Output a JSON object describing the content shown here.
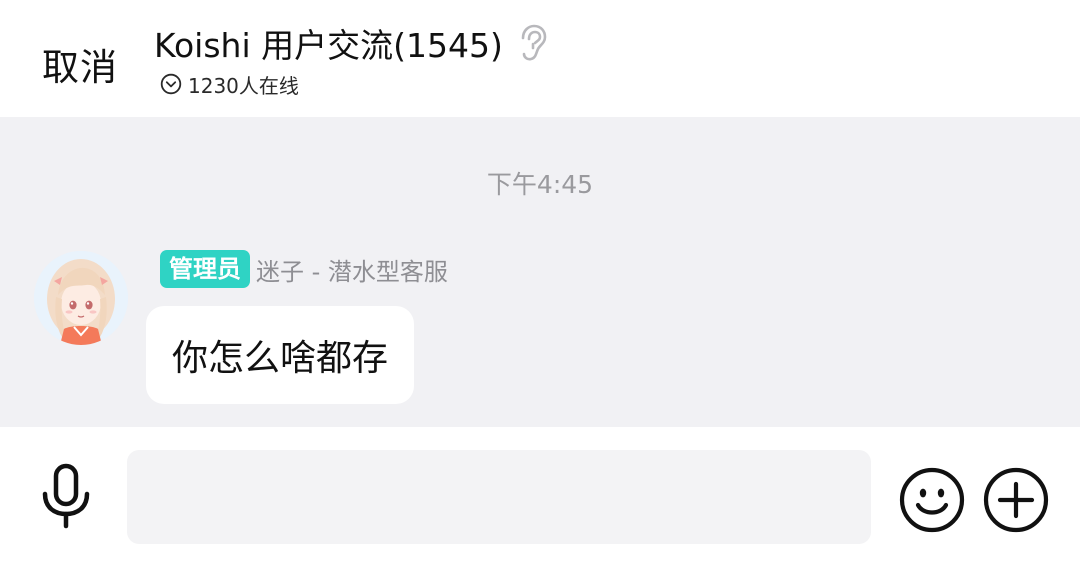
{
  "header": {
    "cancel_label": "取消",
    "title": "Koishi 用户交流(1545)",
    "title_icon": "ear-icon",
    "online_icon": "chevron-circle-down-icon",
    "online_text": "1230人在线"
  },
  "chat": {
    "timestamp": "下午4:45",
    "messages": [
      {
        "avatar": "anime-avatar",
        "role_badge": "管理员",
        "sender": "迷子 - 潜水型客服",
        "text": "你怎么啥都存"
      }
    ]
  },
  "input_bar": {
    "voice_icon": "microphone-icon",
    "input_value": "",
    "emoji_icon": "smiley-icon",
    "more_icon": "plus-circle-icon"
  },
  "colors": {
    "badge": "#2fd3c4",
    "chat_bg": "#f1f1f4",
    "bubble": "#ffffff"
  }
}
